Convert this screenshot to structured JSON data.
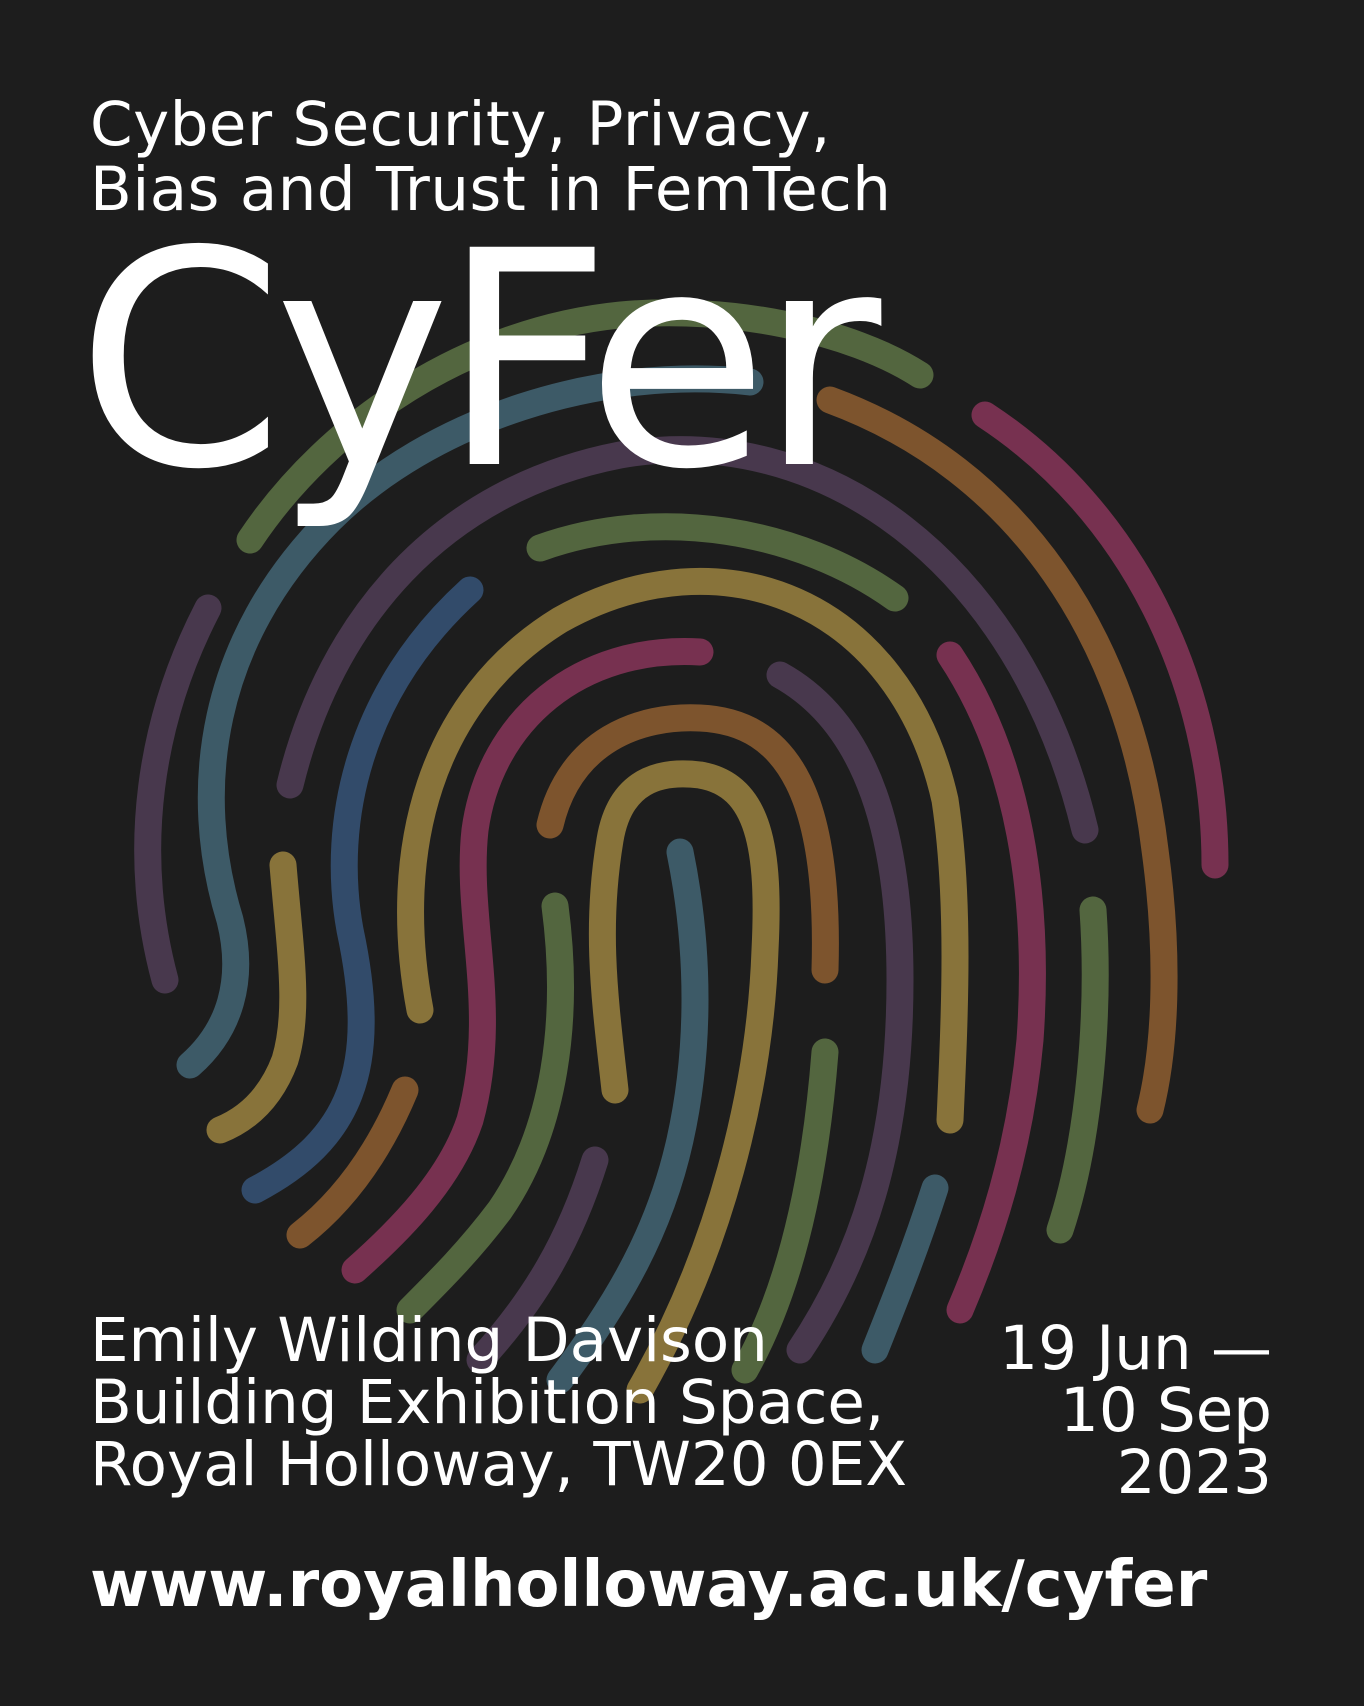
{
  "subtitle": {
    "line1": "Cyber Security, Privacy,",
    "line2": "Bias and Trust in FemTech"
  },
  "title": "CyFer",
  "venue": {
    "line1": "Emily Wilding Davison",
    "line2": "Building Exhibition Space,",
    "line3": "Royal Holloway, TW20 0EX"
  },
  "dates": {
    "line1": "19 Jun —",
    "line2": "10 Sep",
    "line3": "2023"
  },
  "url": "www.royalholloway.ac.uk/cyfer",
  "colors": {
    "background": "#1d1d1d",
    "text": "#ffffff",
    "green": "#53663f",
    "teal": "#3d5a67",
    "purple": "#48384d",
    "brown": "#7d542d",
    "magenta": "#773150",
    "ochre": "#88733a",
    "blue": "#324b6a"
  }
}
